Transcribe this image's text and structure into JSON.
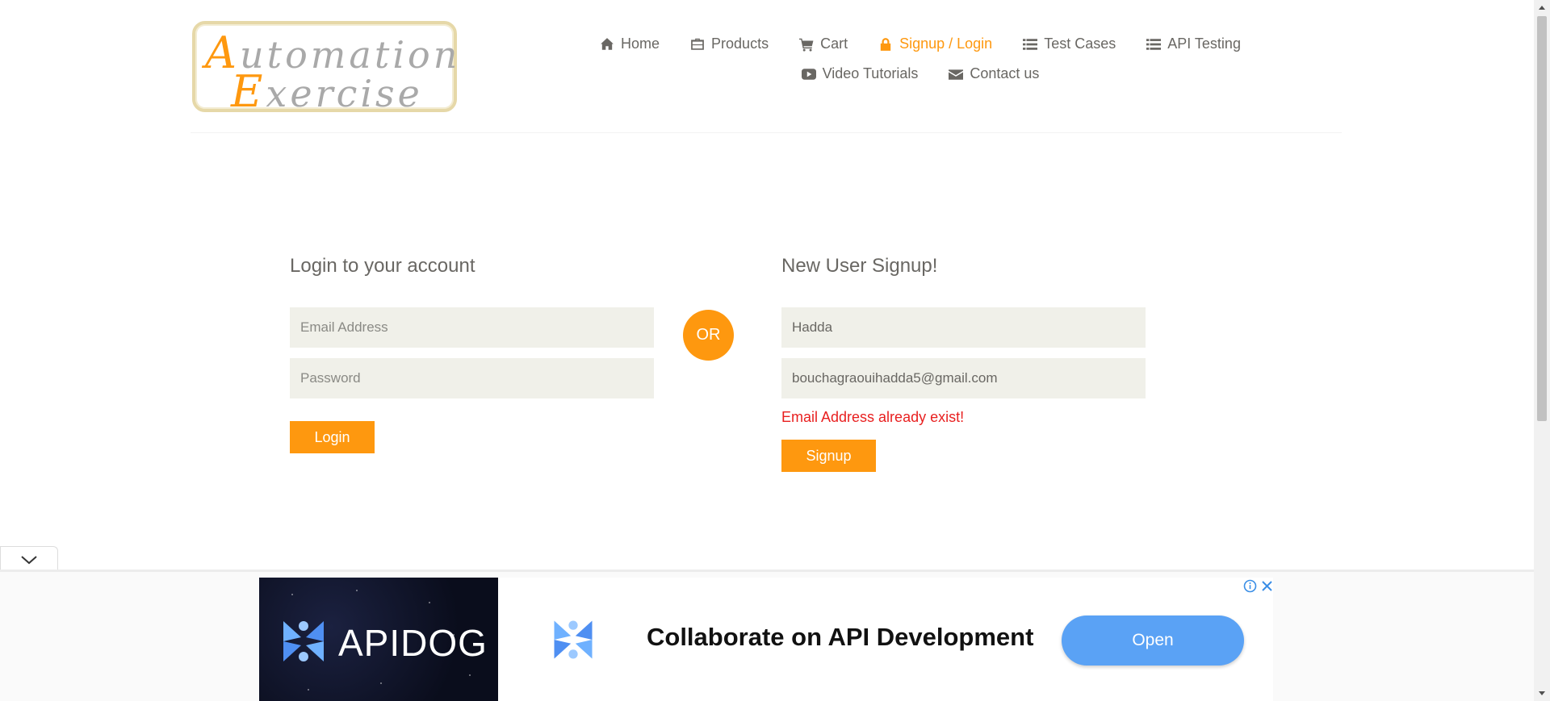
{
  "logo": {
    "line1_cap": "A",
    "line1_rest": "utomation",
    "line2_cap": "E",
    "line2_rest": "xercise"
  },
  "nav": {
    "row1": [
      {
        "label": "Home",
        "icon": "home-icon"
      },
      {
        "label": "Products",
        "icon": "briefcase-icon"
      },
      {
        "label": "Cart",
        "icon": "cart-icon"
      },
      {
        "label": "Signup / Login",
        "icon": "lock-icon",
        "active": true
      },
      {
        "label": "Test Cases",
        "icon": "list-icon"
      },
      {
        "label": "API Testing",
        "icon": "list-icon"
      }
    ],
    "row2": [
      {
        "label": "Video Tutorials",
        "icon": "youtube-play-icon"
      },
      {
        "label": "Contact us",
        "icon": "envelope-icon"
      }
    ]
  },
  "login": {
    "title": "Login to your account",
    "email_placeholder": "Email Address",
    "password_placeholder": "Password",
    "button": "Login"
  },
  "or_label": "OR",
  "signup": {
    "title": "New User Signup!",
    "name_value": "Hadda",
    "email_value": "bouchagraouihadda5@gmail.com",
    "error": "Email Address already exist!",
    "button": "Signup"
  },
  "ad": {
    "brand": "APIDOG",
    "headline": "Collaborate on API Development",
    "cta": "Open"
  },
  "colors": {
    "accent": "#fe980f",
    "text": "#696763",
    "input_bg": "#f0f0e9",
    "error": "#e81f1f",
    "ad_button": "#5aa2f5"
  }
}
